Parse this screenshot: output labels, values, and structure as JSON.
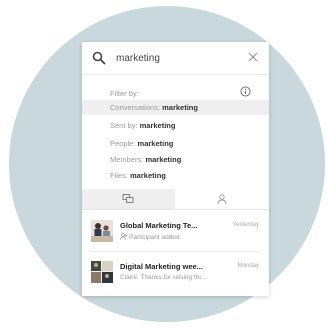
{
  "search": {
    "value": "marketing"
  },
  "filter": {
    "label": "Filter by:",
    "items": [
      {
        "prefix": "Conversations: ",
        "keyword": "marketing",
        "active": true
      },
      {
        "prefix": "Sent by: ",
        "keyword": "marketing",
        "active": false
      },
      {
        "prefix": "People: ",
        "keyword": "marketing",
        "active": false
      },
      {
        "prefix": "Members: ",
        "keyword": "marketing",
        "active": false
      },
      {
        "prefix": "Files: ",
        "keyword": "marketing",
        "active": false
      }
    ]
  },
  "tabs": [
    {
      "icon": "conversations-icon",
      "active": true
    },
    {
      "icon": "people-icon",
      "active": false
    }
  ],
  "results": [
    {
      "title": "Global Marketing Te...",
      "time": "Yesterday",
      "subtitle": "Participant added",
      "subtitle_icon": "participant-icon"
    },
    {
      "title": "Digital Marketing wee...",
      "time": "Monday",
      "subtitle": "Claire: Thanks for raising thi..."
    }
  ],
  "colors": {
    "background_circle": "#c8d8dd",
    "panel": "#ffffff",
    "active_row": "#efefef"
  }
}
